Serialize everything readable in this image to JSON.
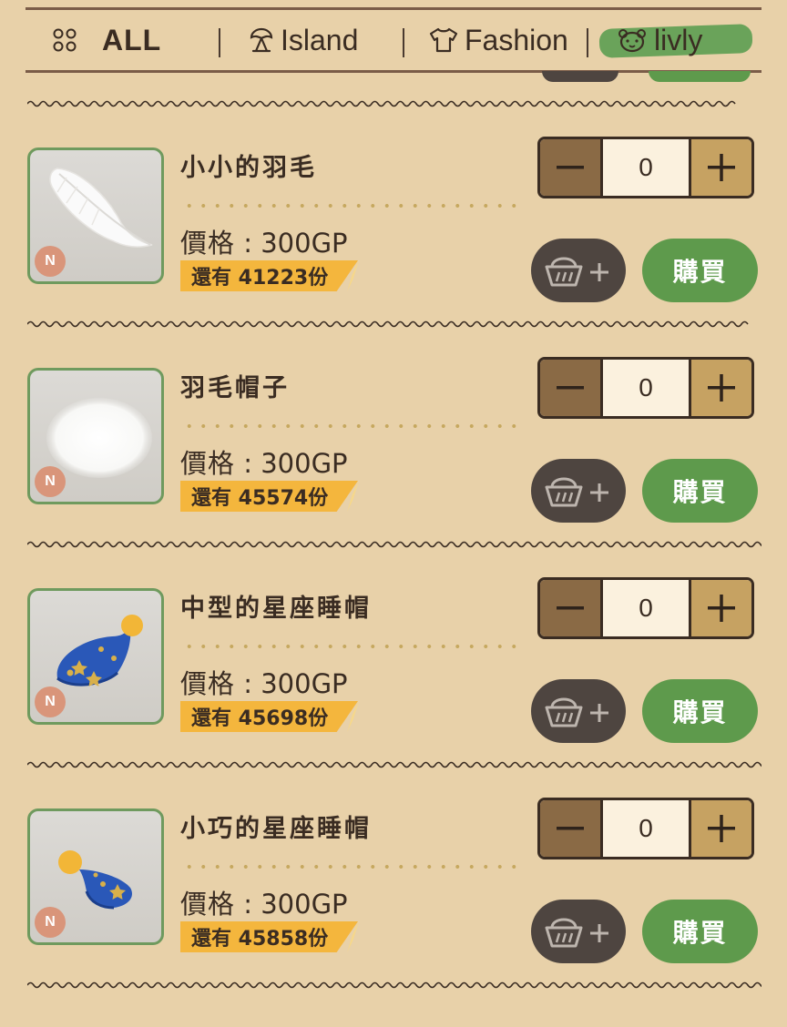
{
  "tabs": [
    {
      "label": "ALL",
      "icon": "four-dots-icon"
    },
    {
      "label": "Island",
      "icon": "palm-tree-icon"
    },
    {
      "label": "Fashion",
      "icon": "tshirt-icon"
    },
    {
      "label": "livly",
      "icon": "livly-face-icon",
      "active": true
    }
  ],
  "colors": {
    "background": "#e8d1a9",
    "accent_green": "#5e9a4c",
    "stock_badge": "#f4b63d",
    "cart_button": "#4e4540"
  },
  "items": [
    {
      "name": "小小的羽毛",
      "price_label": "價格",
      "price_value": "300GP",
      "stock": "還有 41223份",
      "qty": "0",
      "rarity": "N",
      "buy_label": "購買",
      "image": "feather-icon"
    },
    {
      "name": "羽毛帽子",
      "price_label": "價格",
      "price_value": "300GP",
      "stock": "還有 45574份",
      "qty": "0",
      "rarity": "N",
      "buy_label": "購買",
      "image": "feather-hat-icon"
    },
    {
      "name": "中型的星座睡帽",
      "price_label": "價格",
      "price_value": "300GP",
      "stock": "還有 45698份",
      "qty": "0",
      "rarity": "N",
      "buy_label": "購買",
      "image": "star-nightcap-icon"
    },
    {
      "name": "小巧的星座睡帽",
      "price_label": "價格",
      "price_value": "300GP",
      "stock": "還有 45858份",
      "qty": "0",
      "rarity": "N",
      "buy_label": "購買",
      "image": "small-star-nightcap-icon"
    }
  ]
}
